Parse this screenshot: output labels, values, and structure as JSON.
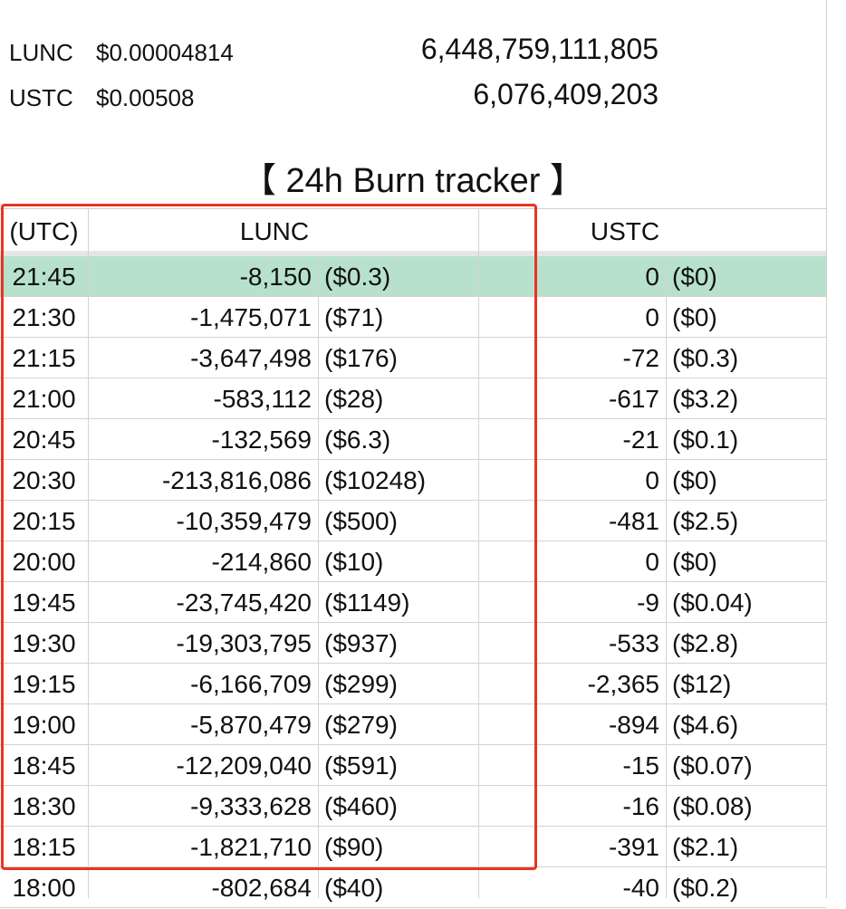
{
  "prices": [
    {
      "symbol": "LUNC",
      "price": "$0.00004814",
      "supply": "6,448,759,111,805"
    },
    {
      "symbol": "USTC",
      "price": "$0.00508",
      "supply": "6,076,409,203"
    }
  ],
  "title": "【 24h Burn tracker 】",
  "headers": {
    "time": "(UTC)",
    "lunc": "LUNC",
    "ustc": "USTC"
  },
  "rows": [
    {
      "time": "21:45",
      "lunc": "-8,150",
      "lunc_usd": "($0.3)",
      "ustc": "0",
      "ustc_usd": "($0)"
    },
    {
      "time": "21:30",
      "lunc": "-1,475,071",
      "lunc_usd": "($71)",
      "ustc": "0",
      "ustc_usd": "($0)"
    },
    {
      "time": "21:15",
      "lunc": "-3,647,498",
      "lunc_usd": "($176)",
      "ustc": "-72",
      "ustc_usd": "($0.3)"
    },
    {
      "time": "21:00",
      "lunc": "-583,112",
      "lunc_usd": "($28)",
      "ustc": "-617",
      "ustc_usd": "($3.2)"
    },
    {
      "time": "20:45",
      "lunc": "-132,569",
      "lunc_usd": "($6.3)",
      "ustc": "-21",
      "ustc_usd": "($0.1)"
    },
    {
      "time": "20:30",
      "lunc": "-213,816,086",
      "lunc_usd": "($10248)",
      "ustc": "0",
      "ustc_usd": "($0)"
    },
    {
      "time": "20:15",
      "lunc": "-10,359,479",
      "lunc_usd": "($500)",
      "ustc": "-481",
      "ustc_usd": "($2.5)"
    },
    {
      "time": "20:00",
      "lunc": "-214,860",
      "lunc_usd": "($10)",
      "ustc": "0",
      "ustc_usd": "($0)"
    },
    {
      "time": "19:45",
      "lunc": "-23,745,420",
      "lunc_usd": "($1149)",
      "ustc": "-9",
      "ustc_usd": "($0.04)"
    },
    {
      "time": "19:30",
      "lunc": "-19,303,795",
      "lunc_usd": "($937)",
      "ustc": "-533",
      "ustc_usd": "($2.8)"
    },
    {
      "time": "19:15",
      "lunc": "-6,166,709",
      "lunc_usd": "($299)",
      "ustc": "-2,365",
      "ustc_usd": "($12)"
    },
    {
      "time": "19:00",
      "lunc": "-5,870,479",
      "lunc_usd": "($279)",
      "ustc": "-894",
      "ustc_usd": "($4.6)"
    },
    {
      "time": "18:45",
      "lunc": "-12,209,040",
      "lunc_usd": "($591)",
      "ustc": "-15",
      "ustc_usd": "($0.07)"
    },
    {
      "time": "18:30",
      "lunc": "-9,333,628",
      "lunc_usd": "($460)",
      "ustc": "-16",
      "ustc_usd": "($0.08)"
    },
    {
      "time": "18:15",
      "lunc": "-1,821,710",
      "lunc_usd": "($90)",
      "ustc": "-391",
      "ustc_usd": "($2.1)"
    },
    {
      "time": "18:00",
      "lunc": "-802,684",
      "lunc_usd": "($40)",
      "ustc": "-40",
      "ustc_usd": "($0.2)"
    }
  ],
  "colors": {
    "highlight_row": "#b7e1cd",
    "annotation_box": "#ea3323",
    "grid": "#d3d3d3"
  }
}
